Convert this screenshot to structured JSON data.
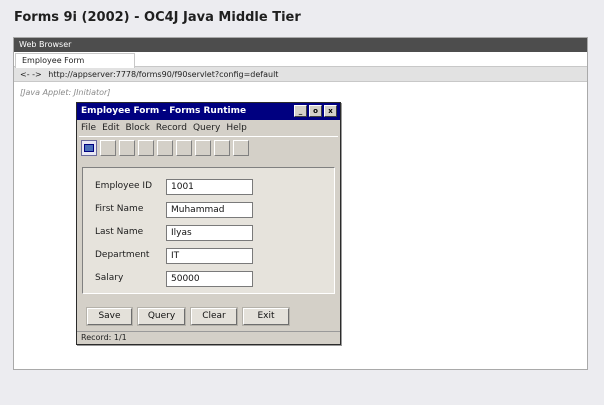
{
  "page": {
    "title": "Forms 9i (2002) - OC4J Java Middle Tier"
  },
  "browser": {
    "title": "Web Browser",
    "tab_label": "Employee Form",
    "nav_arrows": "<- ->",
    "url": "http://appserver:7778/forms90/f90servlet?config=default",
    "applet_caption": "[Java Applet: JInitiator]"
  },
  "forms_window": {
    "title": "Employee Form - Forms Runtime",
    "controls": {
      "minimize": "_",
      "maximize": "o",
      "close": "x"
    },
    "menu": [
      "File",
      "Edit",
      "Block",
      "Record",
      "Query",
      "Help"
    ],
    "fields": {
      "employee_id": {
        "label": "Employee ID",
        "value": "1001"
      },
      "first_name": {
        "label": "First Name",
        "value": "Muhammad"
      },
      "last_name": {
        "label": "Last Name",
        "value": "Ilyas"
      },
      "department": {
        "label": "Department",
        "value": "IT"
      },
      "salary": {
        "label": "Salary",
        "value": "50000"
      }
    },
    "buttons": {
      "save": "Save",
      "query": "Query",
      "clear": "Clear",
      "exit": "Exit"
    },
    "status": "Record: 1/1"
  },
  "colors": {
    "title_bar": "#000080",
    "browser_titlebar": "#4d4d4d",
    "window_face": "#d4d0c8"
  }
}
